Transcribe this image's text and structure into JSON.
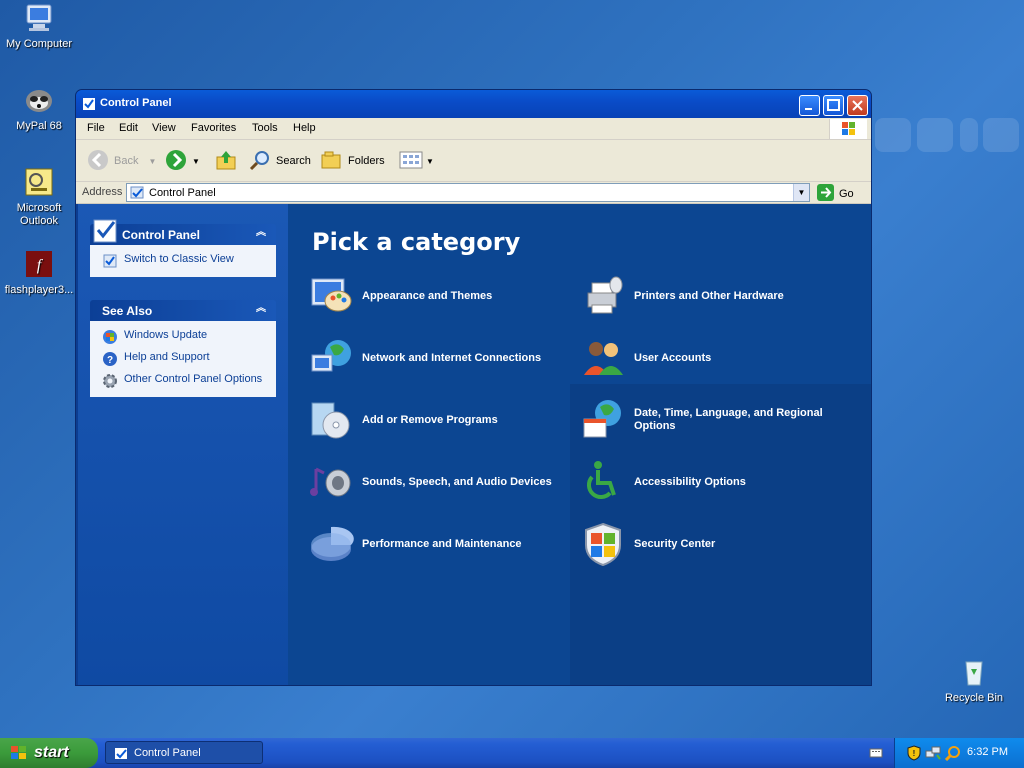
{
  "desktop": {
    "icons": [
      {
        "label": "My Computer"
      },
      {
        "label": "MyPal 68"
      },
      {
        "label": "Microsoft Outlook"
      },
      {
        "label": "flashplayer3..."
      },
      {
        "label": "Recycle Bin"
      }
    ]
  },
  "window": {
    "title": "Control Panel",
    "menu": [
      "File",
      "Edit",
      "View",
      "Favorites",
      "Tools",
      "Help"
    ],
    "toolbar": {
      "back": "Back",
      "search": "Search",
      "folders": "Folders"
    },
    "address": {
      "label": "Address",
      "value": "Control Panel",
      "go": "Go"
    }
  },
  "left_panel": {
    "control_panel": {
      "title": "Control Panel",
      "links": [
        {
          "label": "Switch to Classic View"
        }
      ]
    },
    "see_also": {
      "title": "See Also",
      "links": [
        {
          "label": "Windows Update"
        },
        {
          "label": "Help and Support"
        },
        {
          "label": "Other Control Panel Options"
        }
      ]
    }
  },
  "main": {
    "heading": "Pick a category",
    "categories": [
      {
        "label": "Appearance and Themes"
      },
      {
        "label": "Printers and Other Hardware"
      },
      {
        "label": "Network and Internet Connections"
      },
      {
        "label": "User Accounts"
      },
      {
        "label": "Add or Remove Programs"
      },
      {
        "label": "Date, Time, Language, and Regional Options"
      },
      {
        "label": "Sounds, Speech, and Audio Devices"
      },
      {
        "label": "Accessibility Options"
      },
      {
        "label": "Performance and Maintenance"
      },
      {
        "label": "Security Center"
      }
    ]
  },
  "taskbar": {
    "start": "start",
    "task_button": "Control Panel",
    "clock": "6:32 PM"
  }
}
